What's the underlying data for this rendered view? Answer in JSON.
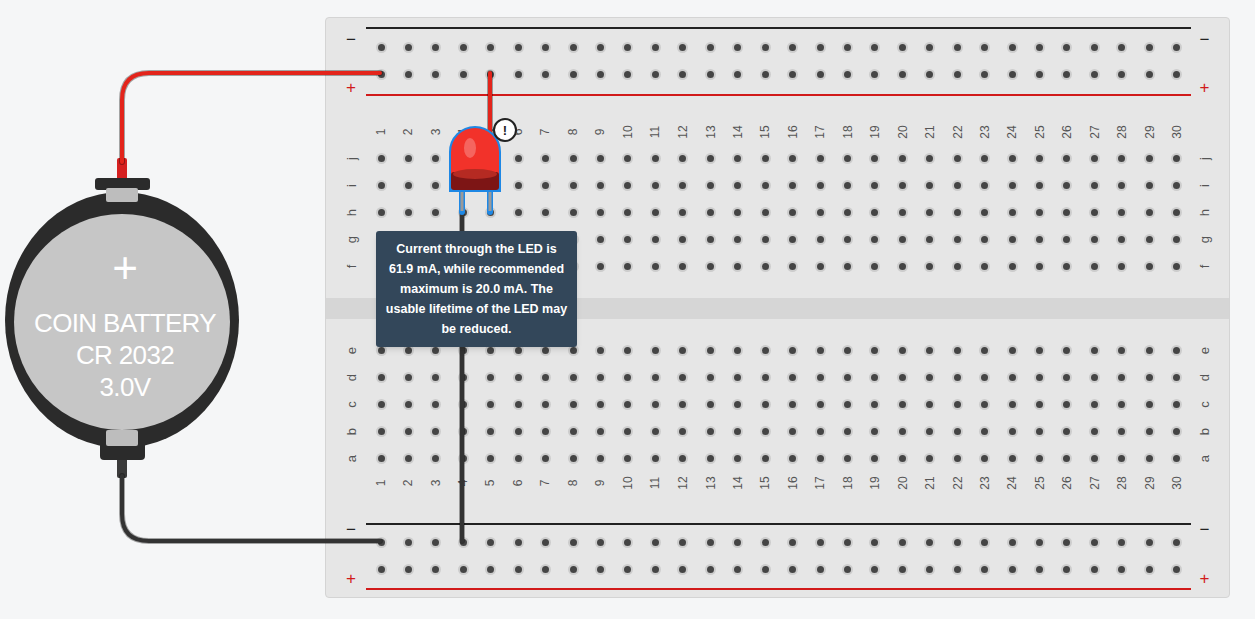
{
  "breadboard": {
    "columns": [
      "1",
      "2",
      "3",
      "4",
      "5",
      "6",
      "7",
      "8",
      "9",
      "10",
      "11",
      "12",
      "13",
      "14",
      "15",
      "16",
      "17",
      "18",
      "19",
      "20",
      "21",
      "22",
      "23",
      "24",
      "25",
      "26",
      "27",
      "28",
      "29",
      "30"
    ],
    "top_rows": [
      "j",
      "i",
      "h",
      "g",
      "f"
    ],
    "bottom_rows": [
      "e",
      "d",
      "c",
      "b",
      "a"
    ],
    "top_rail": {
      "upper_label": "−",
      "lower_label": "+"
    },
    "bottom_rail": {
      "upper_label": "−",
      "lower_label": "+"
    }
  },
  "battery": {
    "polarity": "+",
    "lines": [
      "COIN BATTERY",
      "CR 2032",
      "3.0V"
    ]
  },
  "led": {
    "color": "#f2322a",
    "selected": true,
    "warning": "!"
  },
  "tooltip": {
    "text": "Current through the LED is 61.9 mA, while recommended maximum is 20.0 mA. The usable lifetime of the LED may be reduced."
  },
  "wires": [
    {
      "color": "#e3241b"
    },
    {
      "color": "#e3241b"
    },
    {
      "color": "#333333"
    },
    {
      "color": "#333333"
    }
  ]
}
